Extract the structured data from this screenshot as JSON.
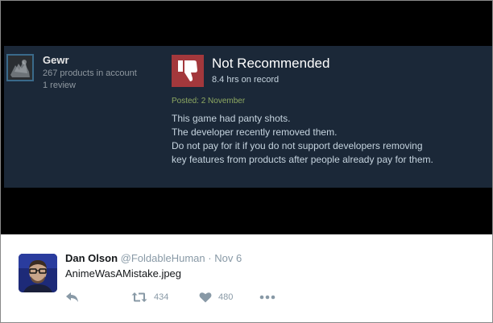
{
  "review": {
    "user": {
      "name": "Gewr",
      "products": "267 products in account",
      "reviews": "1 review"
    },
    "verdict": "Not Recommended",
    "hours": "8.4 hrs on record",
    "posted": "Posted: 2 November",
    "body_lines": [
      "This game had panty shots.",
      "The developer recently removed them.",
      "Do not pay for it if you do not support developers removing",
      "key features from products after people already pay for them."
    ],
    "colors": {
      "card_bg": "#1b2838",
      "thumb_bg": "#a3383c",
      "posted": "#8ea962"
    }
  },
  "tweet": {
    "author": "Dan Olson",
    "handle": "@FoldableHuman",
    "separator": "·",
    "date": "Nov 6",
    "text": "AnimeWasAMistake.jpeg",
    "retweets": "434",
    "likes": "480",
    "icons": [
      "reply-icon",
      "retweet-icon",
      "heart-icon",
      "more-icon"
    ]
  }
}
